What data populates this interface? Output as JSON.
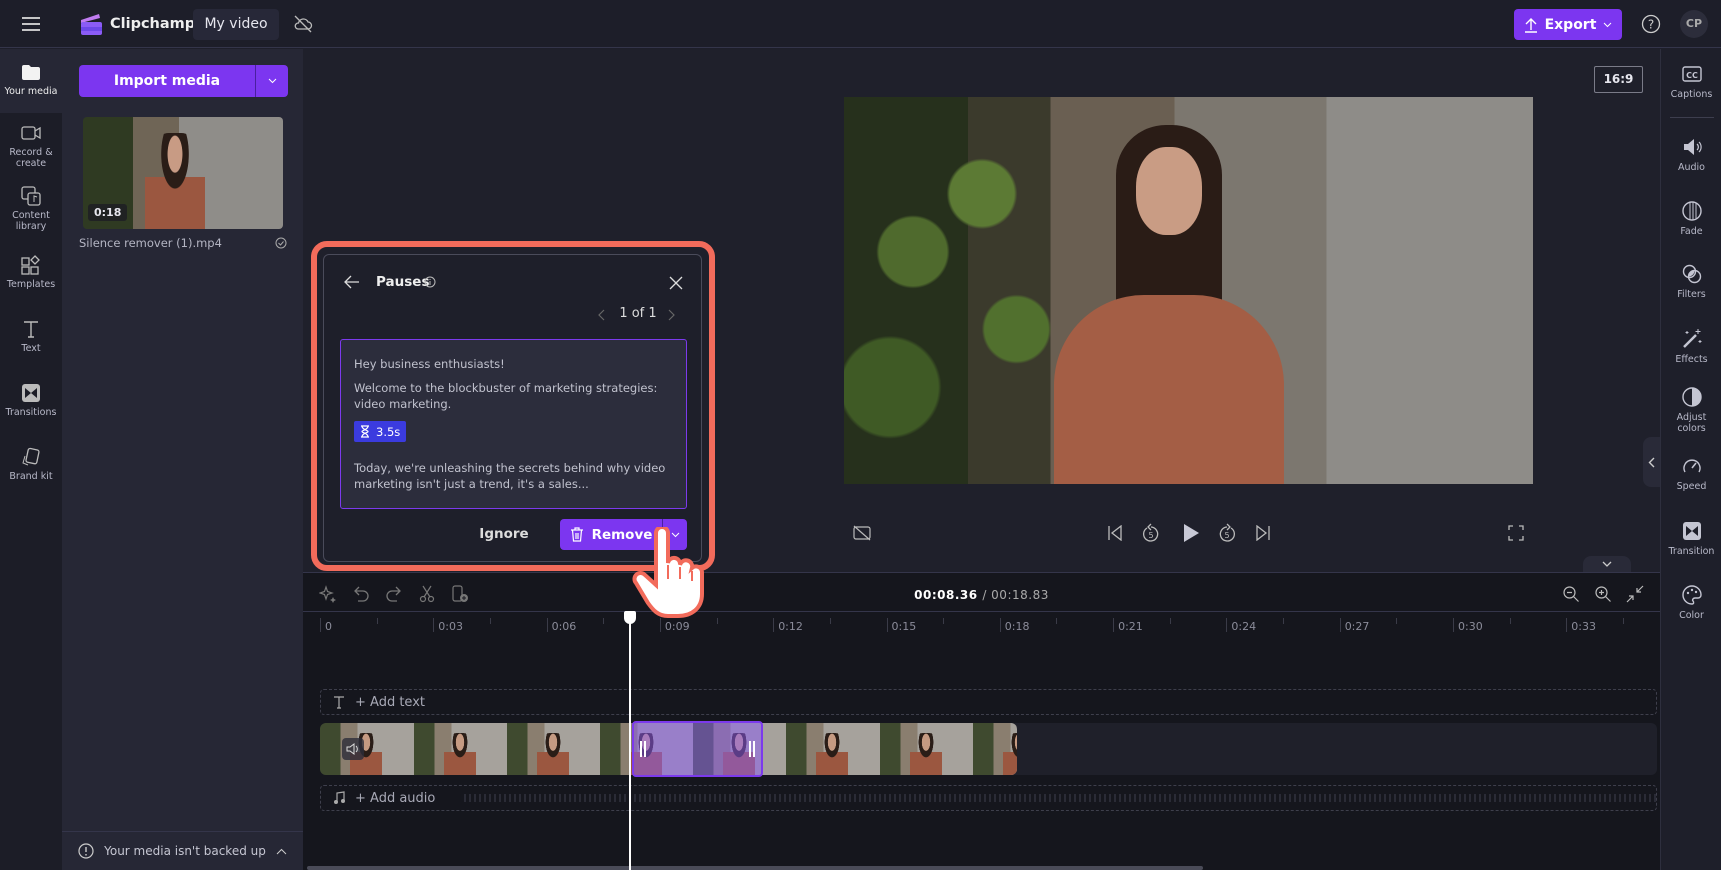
{
  "app": {
    "name": "Clipchamp",
    "project_title": "My video",
    "cloud_status_icon": "cloud-off-icon"
  },
  "header": {
    "export_label": "Export",
    "help_icon": "help-icon",
    "avatar_initials": "CP"
  },
  "left_nav": [
    {
      "label": "Your media",
      "icon": "folder-icon",
      "active": true
    },
    {
      "label": "Record &",
      "label2": "create",
      "icon": "camera-icon"
    },
    {
      "label": "Content",
      "label2": "library",
      "icon": "content-library-icon"
    },
    {
      "label": "Templates",
      "icon": "templates-icon"
    },
    {
      "label": "Text",
      "icon": "text-icon"
    },
    {
      "label": "Transitions",
      "icon": "transitions-icon"
    },
    {
      "label": "Brand kit",
      "icon": "brand-kit-icon"
    }
  ],
  "media_panel": {
    "import_label": "Import media",
    "items": [
      {
        "filename": "Silence remover (1).mp4",
        "duration": "0:18"
      }
    ],
    "backup_notice": "Your media isn't backed up"
  },
  "preview": {
    "aspect_ratio": "16:9"
  },
  "right_sidebar": [
    {
      "label": "Captions",
      "icon": "captions-icon"
    },
    {
      "label": "Audio",
      "icon": "audio-icon"
    },
    {
      "label": "Fade",
      "icon": "fade-icon"
    },
    {
      "label": "Filters",
      "icon": "filters-icon"
    },
    {
      "label": "Effects",
      "icon": "effects-icon"
    },
    {
      "label": "Adjust",
      "label2": "colors",
      "icon": "adjust-colors-icon"
    },
    {
      "label": "Speed",
      "icon": "speed-icon"
    },
    {
      "label": "Transition",
      "icon": "transition-icon"
    },
    {
      "label": "Color",
      "icon": "color-palette-icon"
    }
  ],
  "pauses_dialog": {
    "title": "Pauses",
    "pager": "1 of 1",
    "transcript": {
      "line1": "Hey business enthusiasts!",
      "line2": "Welcome to the blockbuster of marketing strategies: video marketing.",
      "pause_duration": "3.5s",
      "line3": "Today, we're unleashing the secrets behind why video marketing isn't just a trend, it's a sales..."
    },
    "ignore_label": "Ignore",
    "remove_label": "Remove"
  },
  "timeline": {
    "current_time": "00:08.36",
    "total_time": "/ 00:18.83",
    "ruler": [
      "0",
      "0:03",
      "0:06",
      "0:09",
      "0:12",
      "0:15",
      "0:18",
      "0:21",
      "0:24",
      "0:27",
      "0:30",
      "0:33"
    ],
    "add_text_label": "+ Add text",
    "add_audio_label": "+ Add audio"
  },
  "colors": {
    "accent": "#7c36f0",
    "highlight": "#f26b5b",
    "pause_badge": "#3b3bdf"
  }
}
